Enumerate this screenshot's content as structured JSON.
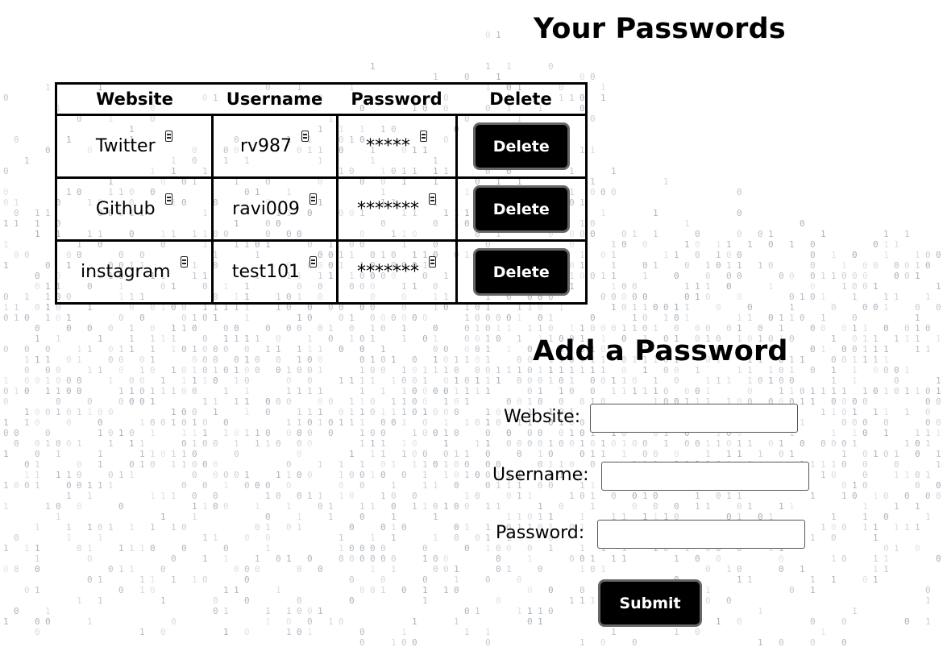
{
  "headings": {
    "passwords": "Your Passwords",
    "add": "Add a Password"
  },
  "table": {
    "headers": [
      "Website",
      "Username",
      "Password",
      "Delete"
    ],
    "rows": [
      {
        "website": "Twitter",
        "username": "rv987",
        "password": "*****",
        "delete_label": "Delete"
      },
      {
        "website": "Github",
        "username": "ravi009",
        "password": "*******",
        "delete_label": "Delete"
      },
      {
        "website": "instagram",
        "username": "test101",
        "password": "*******",
        "delete_label": "Delete"
      }
    ]
  },
  "form": {
    "website_label": "Website:",
    "username_label": "Username:",
    "password_label": "Password:",
    "website_value": "",
    "username_value": "",
    "password_value": "",
    "submit_label": "Submit"
  },
  "colors": {
    "background": "#ffffff",
    "button_bg": "#000000",
    "button_border": "#666666",
    "background_digits": "#8e98a6"
  }
}
